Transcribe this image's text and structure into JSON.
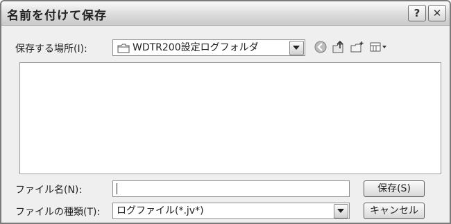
{
  "window": {
    "title": "名前を付けて保存",
    "help_button": "?",
    "close_button": "✕"
  },
  "location": {
    "label": "保存する場所(I):",
    "value": "WDTR200設定ログフォルダ"
  },
  "toolbar": {
    "icons": [
      "back-icon",
      "up-folder-icon",
      "new-folder-icon",
      "view-menu-icon"
    ]
  },
  "file_list": {
    "items": []
  },
  "filename": {
    "label": "ファイル名(N):",
    "value": ""
  },
  "filetype": {
    "label": "ファイルの種類(T):",
    "value": "ログファイル(*.jv*)"
  },
  "buttons": {
    "save": "保存(S)",
    "cancel": "キャンセル"
  }
}
